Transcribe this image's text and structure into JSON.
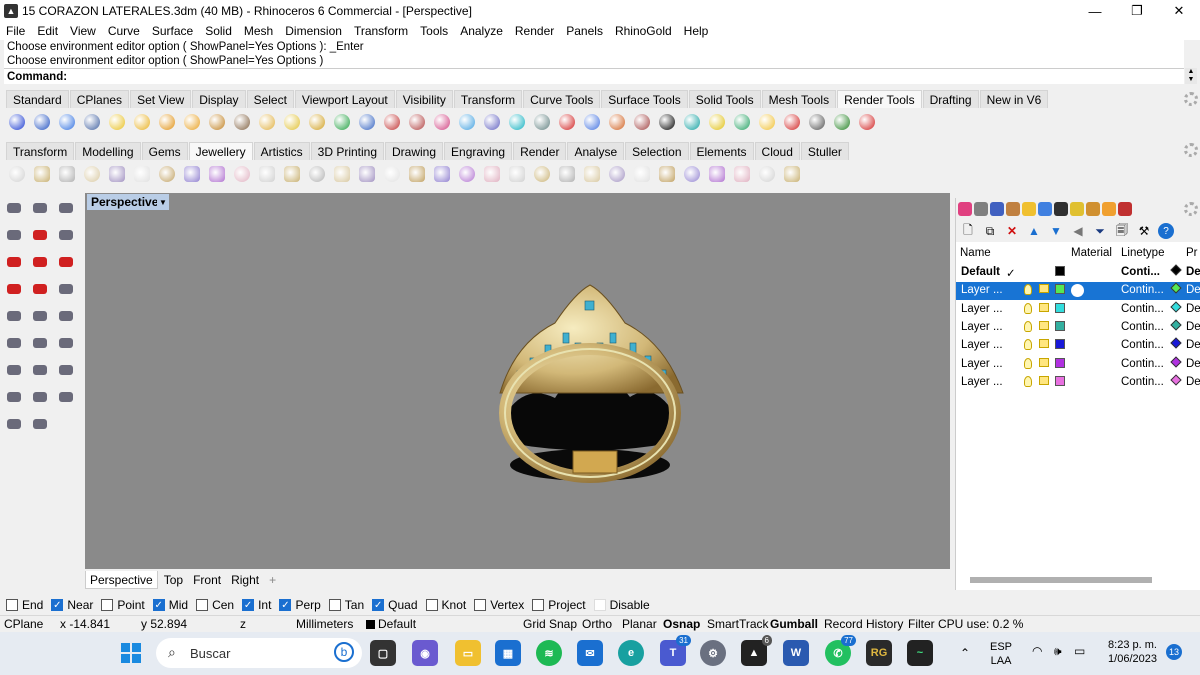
{
  "window": {
    "title": "15 CORAZON LATERALES.3dm (40 MB) - Rhinoceros 6 Commercial - [Perspective]",
    "app_icon": "rhino-icon"
  },
  "menu": [
    "File",
    "Edit",
    "View",
    "Curve",
    "Surface",
    "Solid",
    "Mesh",
    "Dimension",
    "Transform",
    "Tools",
    "Analyze",
    "Render",
    "Panels",
    "RhinoGold",
    "Help"
  ],
  "command": {
    "history": [
      "Choose environment editor option ( ShowPanel=Yes  Options ): _Enter",
      "Choose environment editor option ( ShowPanel=Yes  Options )"
    ],
    "prompt": "Command:",
    "value": ""
  },
  "tabs1": {
    "items": [
      "Standard",
      "CPlanes",
      "Set View",
      "Display",
      "Select",
      "Viewport Layout",
      "Visibility",
      "Transform",
      "Curve Tools",
      "Surface Tools",
      "Solid Tools",
      "Mesh Tools",
      "Render Tools",
      "Drafting",
      "New in V6"
    ],
    "active": "Render Tools"
  },
  "tabs2": {
    "items": [
      "Transform",
      "Modelling",
      "Gems",
      "Jewellery",
      "Artistics",
      "3D Printing",
      "Drawing",
      "Engraving",
      "Render",
      "Analyse",
      "Selection",
      "Elements",
      "Cloud",
      "Stuller"
    ],
    "active": "Jewellery"
  },
  "viewport": {
    "label": "Perspective",
    "tabs": [
      "Perspective",
      "Top",
      "Front",
      "Right"
    ],
    "active_tab": "Perspective",
    "add_tab": "+"
  },
  "layers": {
    "headers": {
      "name": "Name",
      "material": "Material",
      "linetype": "Linetype",
      "print": "Pr"
    },
    "rows": [
      {
        "name": "Default",
        "current": "✓",
        "color": "#000000",
        "linetype": "Conti...",
        "pcolor": "#000000",
        "print": "De",
        "bold": true,
        "selected": false
      },
      {
        "name": "Layer ...",
        "current": "",
        "color": "#55e855",
        "linetype": "Contin...",
        "pcolor": "#55e855",
        "print": "De",
        "bold": false,
        "selected": true
      },
      {
        "name": "Layer ...",
        "current": "",
        "color": "#33dddd",
        "linetype": "Contin...",
        "pcolor": "#33dddd",
        "print": "De",
        "bold": false,
        "selected": false
      },
      {
        "name": "Layer ...",
        "current": "",
        "color": "#33b0a0",
        "linetype": "Contin...",
        "pcolor": "#33b0a0",
        "print": "De",
        "bold": false,
        "selected": false
      },
      {
        "name": "Layer ...",
        "current": "",
        "color": "#1818d8",
        "linetype": "Contin...",
        "pcolor": "#1818d8",
        "print": "De",
        "bold": false,
        "selected": false
      },
      {
        "name": "Layer ...",
        "current": "",
        "color": "#b030e0",
        "linetype": "Contin...",
        "pcolor": "#b030e0",
        "print": "De",
        "bold": false,
        "selected": false
      },
      {
        "name": "Layer ...",
        "current": "",
        "color": "#e870e0",
        "linetype": "Contin...",
        "pcolor": "#e870e0",
        "print": "De",
        "bold": false,
        "selected": false
      }
    ]
  },
  "osnap": [
    {
      "label": "End",
      "checked": false
    },
    {
      "label": "Near",
      "checked": true
    },
    {
      "label": "Point",
      "checked": false
    },
    {
      "label": "Mid",
      "checked": true
    },
    {
      "label": "Cen",
      "checked": false
    },
    {
      "label": "Int",
      "checked": true
    },
    {
      "label": "Perp",
      "checked": true
    },
    {
      "label": "Tan",
      "checked": false
    },
    {
      "label": "Quad",
      "checked": true
    },
    {
      "label": "Knot",
      "checked": false
    },
    {
      "label": "Vertex",
      "checked": false
    },
    {
      "label": "Project",
      "checked": false
    },
    {
      "label": "Disable",
      "checked": false
    }
  ],
  "status": {
    "cplane": "CPlane",
    "x": "x -14.841",
    "y": "y 52.894",
    "z": "z",
    "units": "Millimeters",
    "layer": "Default",
    "grid_snap": "Grid Snap",
    "ortho": "Ortho",
    "planar": "Planar",
    "osnap": "Osnap",
    "smarttrack": "SmartTrack",
    "gumball": "Gumball",
    "record": "Record History",
    "filter": "Filter",
    "cpu": "CPU use: 0.2 %"
  },
  "taskbar": {
    "search_placeholder": "Buscar",
    "lang1": "ESP",
    "lang2": "LAA",
    "time": "8:23 p. m.",
    "date": "1/06/2023",
    "notif": "13",
    "badge_teams": "31",
    "badge_whatsapp": "77",
    "rhino_badge": "6",
    "rg_label": "RG"
  },
  "colors": {
    "accent": "#1874d4",
    "viewport_bg": "#8a8a8a",
    "vp_label_bg": "#b9cde6"
  }
}
